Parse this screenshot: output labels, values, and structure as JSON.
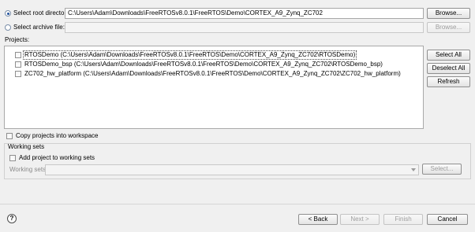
{
  "source": {
    "root_dir_label": "Select root directory:",
    "root_dir_value": "C:\\Users\\Adam\\Downloads\\FreeRTOSv8.0.1\\FreeRTOS\\Demo\\CORTEX_A9_Zynq_ZC702",
    "archive_label": "Select archive file:",
    "archive_value": "",
    "browse_label": "Browse...",
    "browse_archive_label": "Browse..."
  },
  "projects": {
    "label": "Projects:",
    "items": [
      {
        "label": "RTOSDemo (C:\\Users\\Adam\\Downloads\\FreeRTOSv8.0.1\\FreeRTOS\\Demo\\CORTEX_A9_Zynq_ZC702\\RTOSDemo)",
        "checked": false
      },
      {
        "label": "RTOSDemo_bsp (C:\\Users\\Adam\\Downloads\\FreeRTOSv8.0.1\\FreeRTOS\\Demo\\CORTEX_A9_Zynq_ZC702\\RTOSDemo_bsp)",
        "checked": false
      },
      {
        "label": "ZC702_hw_platform (C:\\Users\\Adam\\Downloads\\FreeRTOSv8.0.1\\FreeRTOS\\Demo\\CORTEX_A9_Zynq_ZC702\\ZC702_hw_platform)",
        "checked": false
      }
    ],
    "select_all_label": "Select All",
    "deselect_all_label": "Deselect All",
    "refresh_label": "Refresh"
  },
  "options": {
    "copy_label": "Copy projects into workspace",
    "copy_checked": false
  },
  "working_sets": {
    "group_label": "Working sets",
    "add_label": "Add project to working sets",
    "add_checked": false,
    "sets_label": "Working sets:",
    "sets_value": "",
    "select_label": "Select..."
  },
  "footer": {
    "help_glyph": "?",
    "back_label": "< Back",
    "next_label": "Next >",
    "finish_label": "Finish",
    "cancel_label": "Cancel"
  },
  "colors": {
    "dialog_bg": "#f0f0f0",
    "list_bg": "#ffffff",
    "radio_selected": "#1e4f9c"
  }
}
